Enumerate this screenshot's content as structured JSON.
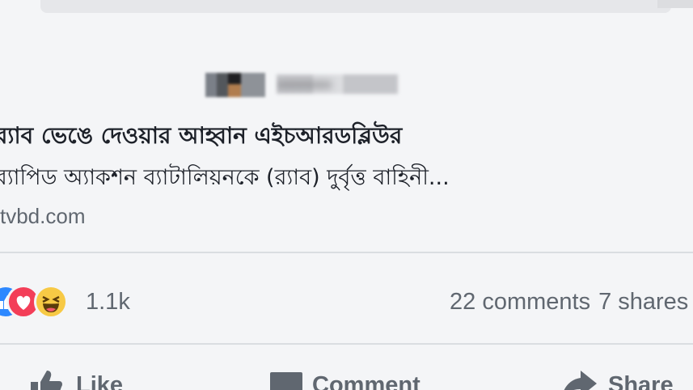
{
  "post": {
    "author_name": "■■■■■■■■",
    "headline": "র‌্যাব ভেঙে দেওয়ার আহ্বান এইচআরডব্লিউর",
    "description": "র‌্যাপিড অ্যাকশন ব্যাটালিয়নকে (র‌্যাব) দুর্বৃত্ত বাহিনী...",
    "domain": "tvbd.com"
  },
  "engagement": {
    "reaction_count": "1.1k",
    "comments": "22 comments",
    "shares": "7 shares",
    "reaction_icons": [
      "like-reaction-icon",
      "love-reaction-icon",
      "haha-reaction-icon"
    ]
  },
  "actions": {
    "like_label": "Like",
    "comment_label": "Comment",
    "share_label": "Share"
  },
  "colors": {
    "like": "#2d88ff",
    "love": "#f33e58",
    "haha": "#f7c945",
    "muted_text": "#606770"
  }
}
